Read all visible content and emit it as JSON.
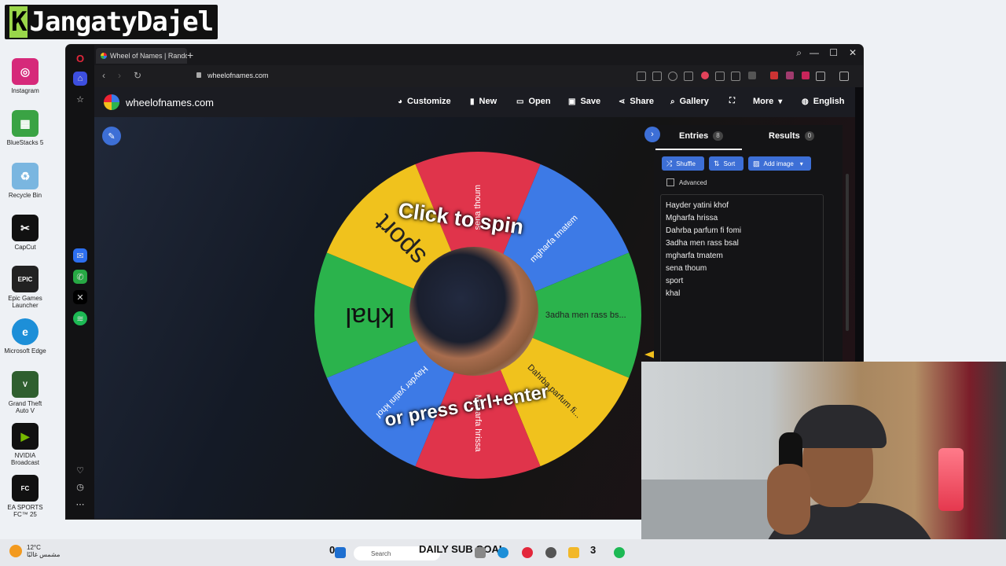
{
  "overlay": {
    "channel_logo_k": "K",
    "channel_logo_rest": "JangatyDajel"
  },
  "desktop_icons": [
    {
      "label": "Instagram",
      "icon": "instagram-icon",
      "color": "#d6297a"
    },
    {
      "label": "BlueStacks 5",
      "icon": "bluestacks-icon",
      "color": "#3aa344"
    },
    {
      "label": "Recycle Bin",
      "icon": "recycle-bin-icon",
      "color": "#7ab6e0"
    },
    {
      "label": "CapCut",
      "icon": "capcut-icon",
      "color": "#111111"
    },
    {
      "label": "Epic Games Launcher",
      "icon": "epic-games-icon",
      "color": "#222222"
    },
    {
      "label": "Microsoft Edge",
      "icon": "edge-icon",
      "color": "#1d8fd8"
    },
    {
      "label": "Grand Theft Auto V",
      "icon": "gta-icon",
      "color": "#2f5f2f"
    },
    {
      "label": "NVIDIA Broadcast",
      "icon": "nvidia-icon",
      "color": "#76b900"
    },
    {
      "label": "EA SPORTS FC™ 25",
      "icon": "ea-fc-icon",
      "color": "#111111"
    }
  ],
  "browser": {
    "tab_title": "Wheel of Names | Random",
    "url": "wheelofnames.com"
  },
  "site": {
    "brand": "wheelofnames.com",
    "menu": [
      {
        "label": "Customize",
        "icon": "palette-icon"
      },
      {
        "label": "New",
        "icon": "file-icon"
      },
      {
        "label": "Open",
        "icon": "folder-icon"
      },
      {
        "label": "Save",
        "icon": "save-icon"
      },
      {
        "label": "Share",
        "icon": "share-icon"
      },
      {
        "label": "Gallery",
        "icon": "search-icon"
      },
      {
        "label": "",
        "icon": "fullscreen-icon"
      },
      {
        "label": "More",
        "icon": "chevron-down-icon"
      },
      {
        "label": "English",
        "icon": "globe-icon"
      }
    ]
  },
  "wheel": {
    "spin_line1": "Click to spin",
    "spin_line2": "or press ctrl+enter",
    "segments": [
      {
        "label": "sena thoum",
        "color": "#e0344b"
      },
      {
        "label": "mgharfa tmatem",
        "color": "#3d7ae6"
      },
      {
        "label": "3adha men rass bs...",
        "color": "#2bb34c"
      },
      {
        "label": "Dahrba parfum fi...",
        "color": "#f0c21d"
      },
      {
        "label": "Mgharfa hrissa",
        "color": "#e0344b"
      },
      {
        "label": "Hayder yatini khof",
        "color": "#3d7ae6"
      },
      {
        "label": "khal",
        "color": "#2bb34c"
      },
      {
        "label": "sport",
        "color": "#f0c21d"
      }
    ]
  },
  "panel": {
    "entries_tab": "Entries",
    "entries_count": "8",
    "results_tab": "Results",
    "results_count": "0",
    "shuffle": "Shuffle",
    "sort": "Sort",
    "add_image": "Add image",
    "advanced": "Advanced",
    "entries": [
      "Hayder yatini khof",
      "Mgharfa hrissa",
      "Dahrba parfum fi fomi",
      "3adha men rass bsal",
      "mgharfa tmatem",
      "sena thoum",
      "sport",
      "khal"
    ]
  },
  "taskbar": {
    "weather_temp": "12°C",
    "weather_desc": "مشمس غالبًا",
    "counter_left": "0",
    "search_placeholder": "Search",
    "goal_text": "DAILY SUB GOAL",
    "counter_right": "3"
  }
}
